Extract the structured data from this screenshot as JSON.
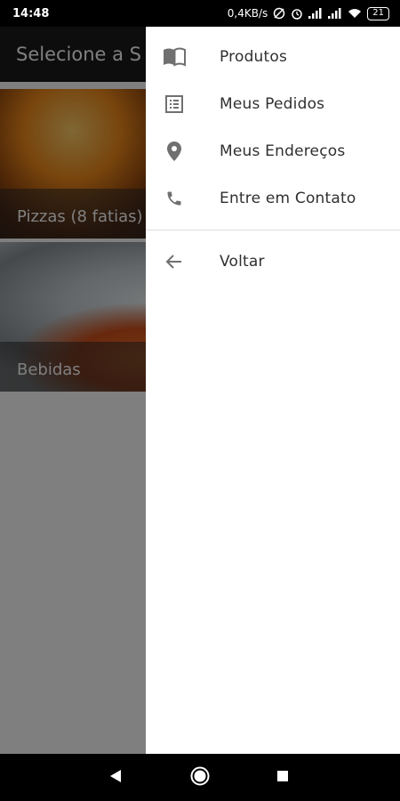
{
  "status_bar": {
    "time": "14:48",
    "speed": "0,4KB/s",
    "battery": "21"
  },
  "app_bar": {
    "title": "Selecione a S"
  },
  "categories": [
    {
      "label": "Pizzas (8 fatias)"
    },
    {
      "label": "Bebidas"
    }
  ],
  "drawer": {
    "items": [
      {
        "label": "Produtos",
        "icon": "book-open-icon"
      },
      {
        "label": "Meus Pedidos",
        "icon": "list-icon"
      },
      {
        "label": "Meus Endereços",
        "icon": "location-pin-icon"
      },
      {
        "label": "Entre em Contato",
        "icon": "phone-icon"
      }
    ],
    "back": {
      "label": "Voltar",
      "icon": "arrow-back-icon"
    }
  },
  "nav_bar": {
    "buttons": [
      "back",
      "home",
      "recents"
    ]
  },
  "colors": {
    "drawer_bg": "#ffffff",
    "icon": "#707070",
    "text": "#303030",
    "scrim": "rgba(0,0,0,0.5)"
  }
}
